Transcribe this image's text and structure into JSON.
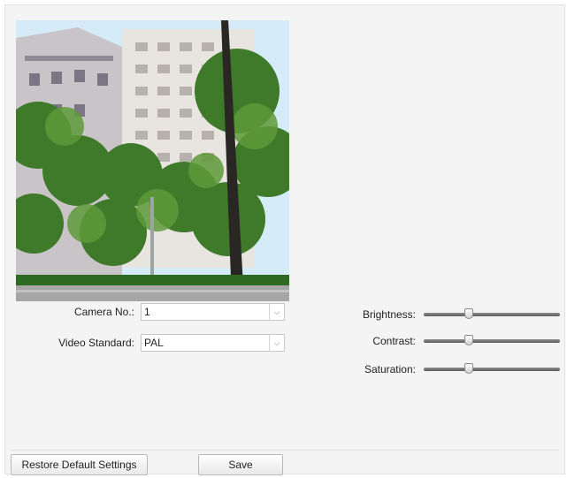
{
  "form": {
    "camera_no_label": "Camera No.:",
    "camera_no_value": "1",
    "video_standard_label": "Video Standard:",
    "video_standard_value": "PAL"
  },
  "image_settings": {
    "brightness_label": "Brightness:",
    "brightness_level": 0.33,
    "contrast_label": "Contrast:",
    "contrast_level": 0.33,
    "saturation_label": "Saturation:",
    "saturation_level": 0.33
  },
  "buttons": {
    "restore_label": "Restore Default Settings",
    "save_label": "Save"
  },
  "icons": {
    "dropdown": "chevron-down-icon"
  },
  "colors": {
    "panel_bg": "#f4f4f4",
    "slider_track": "#707070"
  }
}
